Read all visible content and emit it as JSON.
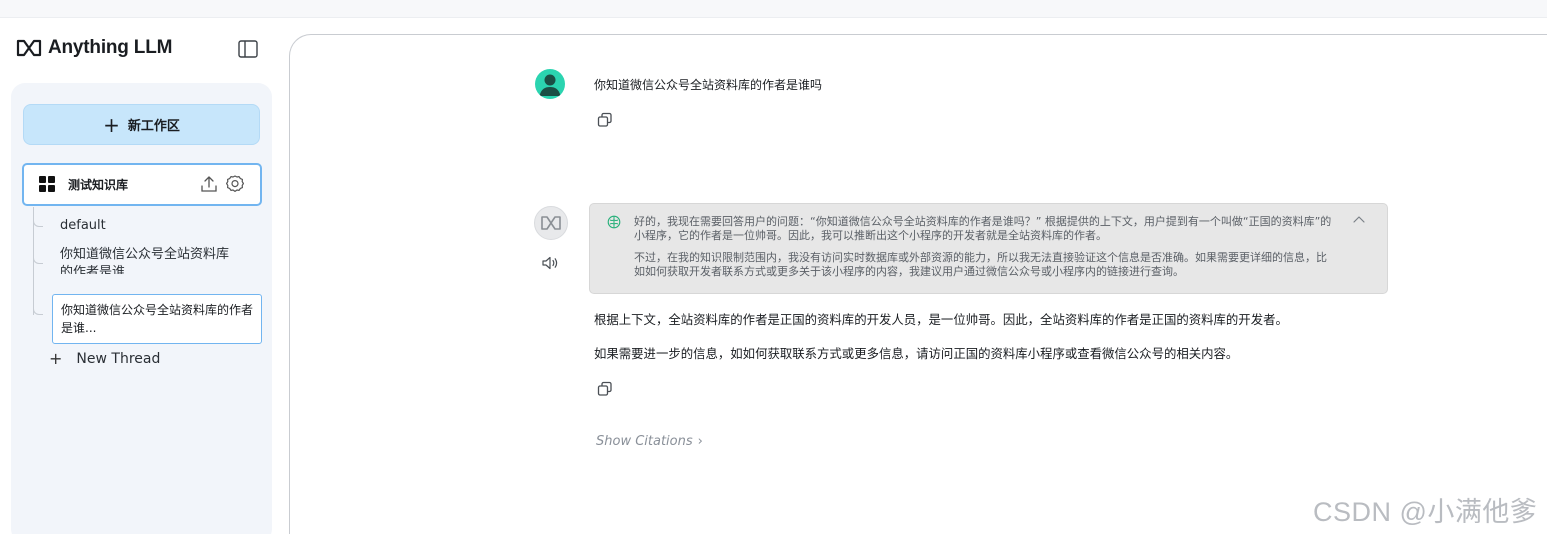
{
  "app": {
    "name": "Anything LLM",
    "logo_icon": "anythingllm-logo-icon"
  },
  "sidebar": {
    "new_workspace_label": "新工作区",
    "workspace": {
      "name": "测试知识库"
    },
    "threads": [
      {
        "label": "default"
      },
      {
        "label": "你知道微信公众号全站资料库的作者是谁"
      }
    ],
    "thread_tooltip": "你知道微信公众号全站资料库的作者是谁...",
    "new_thread_label": "New Thread"
  },
  "chat": {
    "user_message": "你知道微信公众号全站资料库的作者是谁吗",
    "thinking": {
      "paragraph1": "好的，我现在需要回答用户的问题：“你知道微信公众号全站资料库的作者是谁吗？” 根据提供的上下文，用户提到有一个叫做“正国的资料库”的小程序，它的作者是一位帅哥。因此，我可以推断出这个小程序的开发者就是全站资料库的作者。",
      "paragraph2": "不过，在我的知识限制范围内，我没有访问实时数据库或外部资源的能力，所以我无法直接验证这个信息是否准确。如果需要更详细的信息，比如如何获取开发者联系方式或更多关于该小程序的内容，我建议用户通过微信公众号或小程序内的链接进行查询。"
    },
    "answer_lines": [
      "根据上下文，全站资料库的作者是正国的资料库的开发人员，是一位帅哥。因此，全站资料库的作者是正国的资料库的开发者。",
      "如果需要进一步的信息，如如何获取联系方式或更多信息，请访问正国的资料库小程序或查看微信公众号的相关内容。"
    ],
    "show_citations_label": "Show Citations",
    "show_citations_arrow": "›"
  },
  "watermark": "CSDN @小满他爹",
  "colors": {
    "new_workspace_bg": "#c7e6fb",
    "selected_border": "#72b5f0",
    "user_avatar": "#2bd4b0",
    "thinking_bg": "#e7e7e7"
  }
}
